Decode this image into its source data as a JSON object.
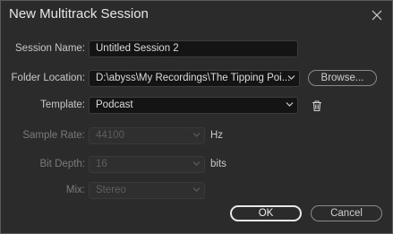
{
  "window": {
    "title": "New Multitrack Session"
  },
  "labels": {
    "session_name": "Session Name:",
    "folder_location": "Folder Location:",
    "template": "Template:",
    "sample_rate": "Sample Rate:",
    "bit_depth": "Bit Depth:",
    "mix": "Mix:"
  },
  "fields": {
    "session_name": "Untitled Session 2",
    "folder_location": "D:\\abyss\\My Recordings\\The Tipping Poi...",
    "template": "Podcast",
    "sample_rate": "44100",
    "bit_depth": "16",
    "mix": "Stereo"
  },
  "units": {
    "sample_rate": "Hz",
    "bit_depth": "bits"
  },
  "buttons": {
    "browse": "Browse...",
    "ok": "OK",
    "cancel": "Cancel"
  },
  "icons": {
    "close": "close-icon",
    "dropdown": "chevron-down-icon",
    "delete": "trash-icon"
  }
}
